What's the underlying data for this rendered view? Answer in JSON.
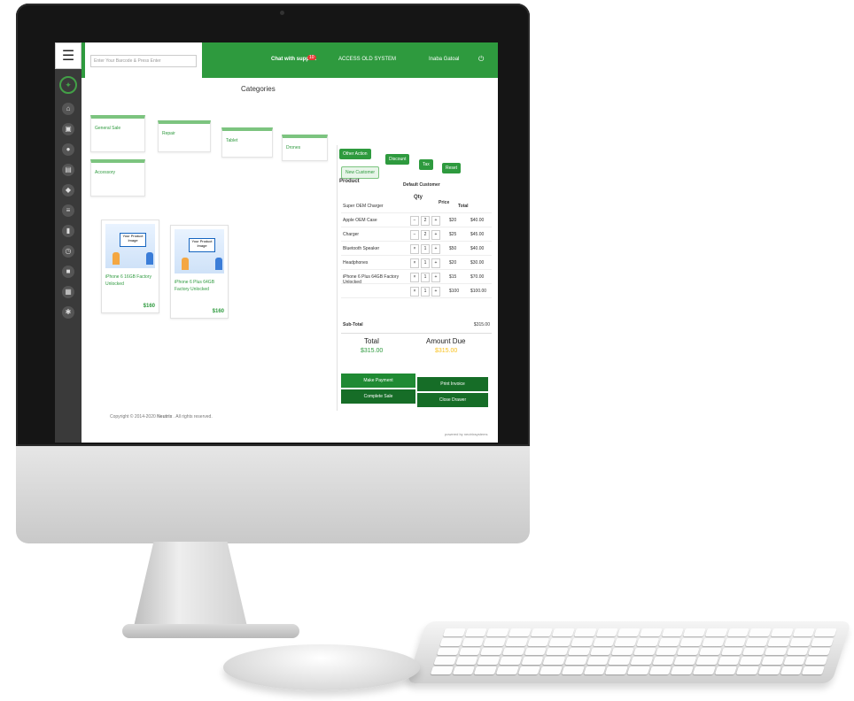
{
  "topbar": {
    "barcode_title": "Enter Barcode",
    "barcode_placeholder": "Enter Your Barcode & Press Enter",
    "support": "Chat with support",
    "notif_count": "10",
    "access": "ACCESS OLD SYSTEM",
    "user": "Inaba Gatoal"
  },
  "categories": {
    "title": "Categories",
    "items": [
      "General Sale",
      "Repair",
      "Tablet",
      "Drones",
      "Accessory"
    ]
  },
  "products": [
    {
      "name": "iPhone 6 16GB Factory Unlocked",
      "price": "$160",
      "image_text": "Your Product Image"
    },
    {
      "name": "iPhone 6 Plus 64GB Factory Unlocked",
      "price": "$160",
      "image_text": "Your Product Image"
    }
  ],
  "cart": {
    "other_action": "Other Action",
    "discount": "Discount",
    "tax": "Tax",
    "reset": "Reset",
    "new_customer": "New Customer",
    "customer_select": "Default Customer",
    "col_product": "Product",
    "col_qty": "Qty",
    "col_price": "Price",
    "col_total": "Total",
    "items": [
      {
        "name": "Super OEM Charger",
        "price": "",
        "total": ""
      },
      {
        "name": "Apple OEM Case",
        "qty": "2",
        "price": "$20",
        "total": "$40.00"
      },
      {
        "name": "Charger",
        "qty": "2",
        "price": "$25",
        "total": "$45.00"
      },
      {
        "name": "Bluetooth Speaker",
        "qty": "1",
        "price": "$50",
        "total": "$40.00"
      },
      {
        "name": "Headphones",
        "qty": "1",
        "price": "$20",
        "total": "$30.00"
      },
      {
        "name": "iPhone 6 Plus 64GB Factory Unlocked",
        "qty": "1",
        "price": "$15",
        "total": "$70.00"
      },
      {
        "name": "",
        "qty": "1",
        "price": "$100",
        "total": "$100.00"
      }
    ],
    "subtotal_label": "Sub-Total",
    "subtotal_value": "$315.00",
    "total_label": "Total",
    "total_value": "$315.00",
    "due_label": "Amount Due",
    "due_value": "$315.00",
    "make_payment": "Make Payment",
    "print_invoice": "Print Invoice",
    "complete_sale": "Complete Sale",
    "close_drawer": "Close Drawer"
  },
  "footer": {
    "copyright_prefix": "Copyright © 2014-2020",
    "brand": "Neutrix",
    "copyright_suffix": ". All rights reserved.",
    "powered": "powered by neutrixsystems"
  },
  "colors": {
    "brand_green": "#2e9a3e",
    "accent_yellow": "#f9c01a"
  },
  "icons": [
    "hamburger-icon",
    "brand-logo-icon",
    "chat-icon",
    "bell-icon",
    "monitor-icon",
    "power-icon"
  ]
}
